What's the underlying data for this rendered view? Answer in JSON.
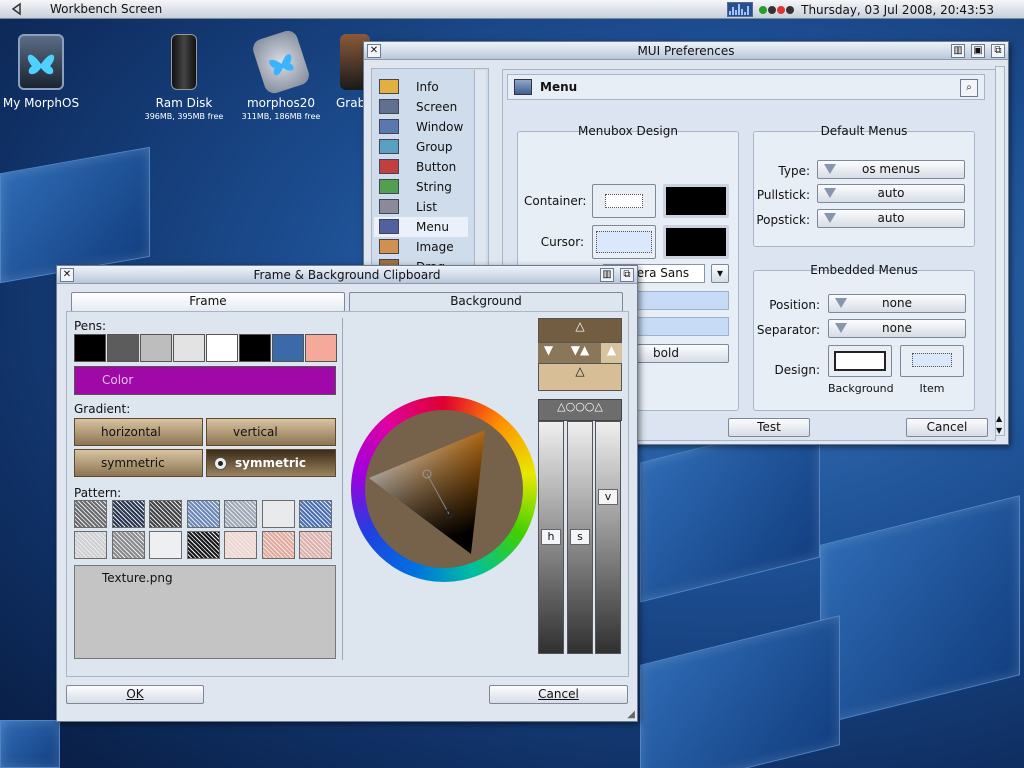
{
  "topbar": {
    "title": "Workbench Screen",
    "clock": "Thursday, 03 Jul 2008, 20:43:53"
  },
  "desktop": [
    {
      "label": "My MorphOS",
      "sub": ""
    },
    {
      "label": "Ram Disk",
      "sub": "396MB, 395MB free"
    },
    {
      "label": "morphos20",
      "sub": "311MB, 186MB free"
    },
    {
      "label": "Grab",
      "sub": ""
    }
  ],
  "mui": {
    "title": "MUI Preferences",
    "sidebar": [
      "Info",
      "Screen",
      "Window",
      "Group",
      "Button",
      "String",
      "List",
      "Menu",
      "Image",
      "Drag"
    ],
    "page_title": "Menu",
    "menubox": {
      "title": "Menubox Design",
      "container": "Container:",
      "cursor": "Cursor:"
    },
    "default_menus": {
      "title": "Default Menus",
      "type_label": "Type:",
      "type_value": "os menus",
      "pullstick_label": "Pullstick:",
      "pullstick_value": "auto",
      "popstick_label": "Popstick:",
      "popstick_value": "auto"
    },
    "embedded": {
      "title": "Embedded Menus",
      "position_label": "Position:",
      "position_value": "none",
      "separator_label": "Separator:",
      "separator_value": "none",
      "design_label": "Design:",
      "background_label": "Background",
      "item_label": "Item"
    },
    "font_value": "m Vera Sans",
    "bold_label": "bold",
    "test": "Test",
    "cancel": "Cancel"
  },
  "clip": {
    "title": "Frame & Background Clipboard",
    "tabs": [
      "Frame",
      "Background"
    ],
    "pens_label": "Pens:",
    "color_label": "Color",
    "gradient_label": "Gradient:",
    "gradient_buttons": [
      "horizontal",
      "vertical",
      "symmetric",
      "symmetric"
    ],
    "pattern_label": "Pattern:",
    "texture": "Texture.png",
    "slider_labels": [
      "h",
      "s",
      "v"
    ],
    "ok": "OK",
    "cancel": "Cancel",
    "pen_colors": [
      "#000000",
      "#5c5c5c",
      "#bdbdbd",
      "#e3e3e3",
      "#ffffff",
      "#000000",
      "#3a6aa8",
      "#f4a99a"
    ],
    "color_value": "#a008a8"
  }
}
